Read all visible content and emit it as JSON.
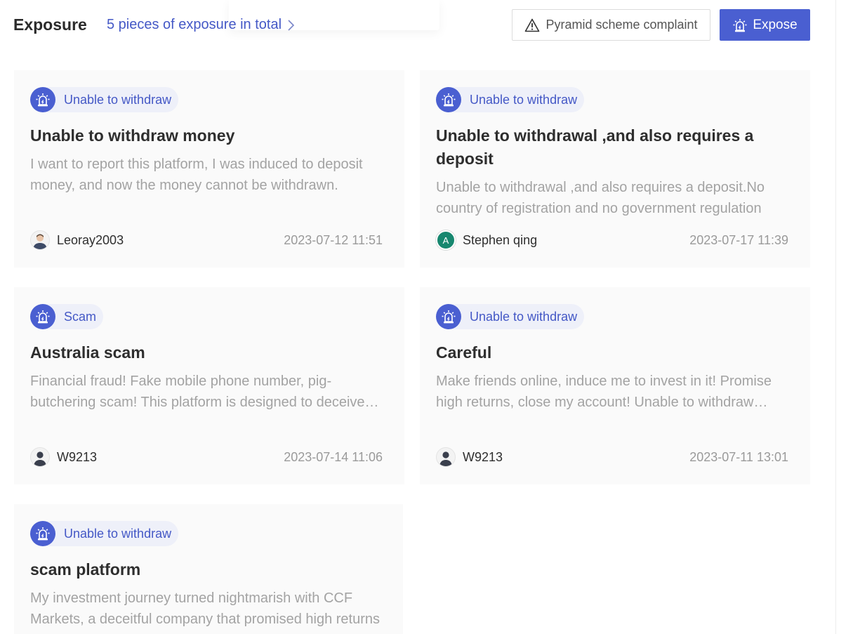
{
  "header": {
    "title": "Exposure",
    "total_link": "5 pieces of exposure in total",
    "complaint_button": "Pyramid scheme complaint",
    "expose_button": "Expose"
  },
  "colors": {
    "accent": "#4a5fd1",
    "link": "#4458c6",
    "card_bg": "#fafafa",
    "tag_bg": "#eef0f9"
  },
  "cards": [
    {
      "tag": "Unable to withdraw",
      "title": "Unable to withdraw money",
      "description": "I want to report this platform, I was induced to deposit money, and now the money cannot be withdrawn.",
      "author": "Leoray2003",
      "avatar": "user-photo",
      "date": "2023-07-12 11:51"
    },
    {
      "tag": "Unable to withdraw",
      "title": "Unable to  withdrawal ,and also requires a deposit",
      "description": "Unable to withdrawal ,and also requires a deposit.No country of registration and no government regulation",
      "author": "Stephen qing",
      "avatar_letter": "A",
      "date": "2023-07-17 11:39"
    },
    {
      "tag": "Scam",
      "title": "Australia scam",
      "description": "Financial fraud! Fake mobile phone number, pig-butchering scam! This platform is designed to deceive investors",
      "author": "W9213",
      "avatar": "user-silhouette",
      "date": "2023-07-14 11:06"
    },
    {
      "tag": "Unable to withdraw",
      "title": "Careful",
      "description": "Make friends online, induce me to invest in it! Promise high returns, close my account! Unable to withdraw money",
      "author": "W9213",
      "avatar": "user-silhouette",
      "date": "2023-07-11 13:01"
    },
    {
      "tag": "Unable to withdraw",
      "title": "scam platform",
      "description": "My investment journey turned nightmarish with CCF Markets, a deceitful company that promised high returns",
      "author": "",
      "avatar": "",
      "date": ""
    }
  ]
}
